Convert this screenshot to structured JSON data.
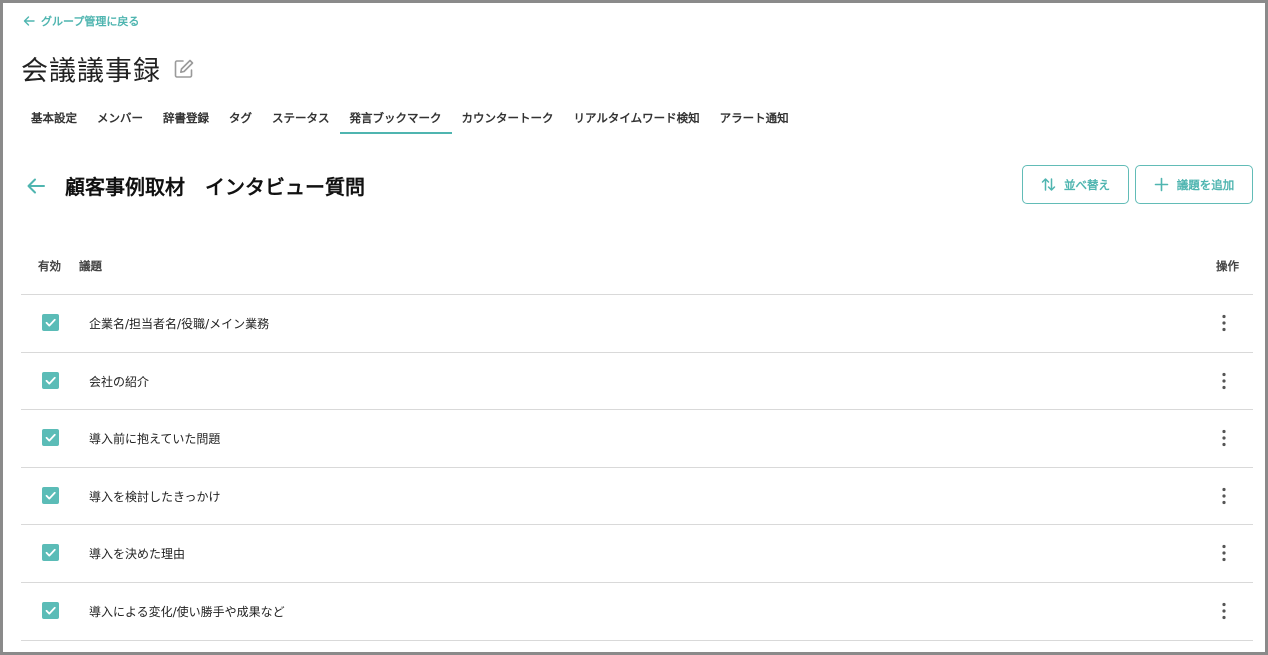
{
  "nav": {
    "back_label": "グループ管理に戻る"
  },
  "page": {
    "title": "会議議事録"
  },
  "tabs": [
    {
      "label": "基本設定"
    },
    {
      "label": "メンバー"
    },
    {
      "label": "辞書登録"
    },
    {
      "label": "タグ"
    },
    {
      "label": "ステータス"
    },
    {
      "label": "発言ブックマーク"
    },
    {
      "label": "カウンタートーク"
    },
    {
      "label": "リアルタイムワード検知"
    },
    {
      "label": "アラート通知"
    }
  ],
  "active_tab": "発言ブックマーク",
  "section": {
    "title": "顧客事例取材　インタビュー質問",
    "sort_label": "並べ替え",
    "add_label": "議題を追加"
  },
  "table": {
    "headers": {
      "enabled": "有効",
      "topic": "議題",
      "actions": "操作"
    },
    "rows": [
      {
        "enabled": true,
        "topic": "企業名/担当者名/役職/メイン業務"
      },
      {
        "enabled": true,
        "topic": "会社の紹介"
      },
      {
        "enabled": true,
        "topic": "導入前に抱えていた問題"
      },
      {
        "enabled": true,
        "topic": "導入を検討したきっかけ"
      },
      {
        "enabled": true,
        "topic": "導入を決めた理由"
      },
      {
        "enabled": true,
        "topic": "導入による変化/使い勝手や成果など"
      }
    ]
  },
  "colors": {
    "accent": "#4fb5b0",
    "checkbox": "#5bbcb7",
    "divider": "#d9d9d9"
  },
  "icons": [
    "arrow-left-icon",
    "edit-icon",
    "sort-icon",
    "plus-icon",
    "check-icon",
    "kebab-icon"
  ]
}
